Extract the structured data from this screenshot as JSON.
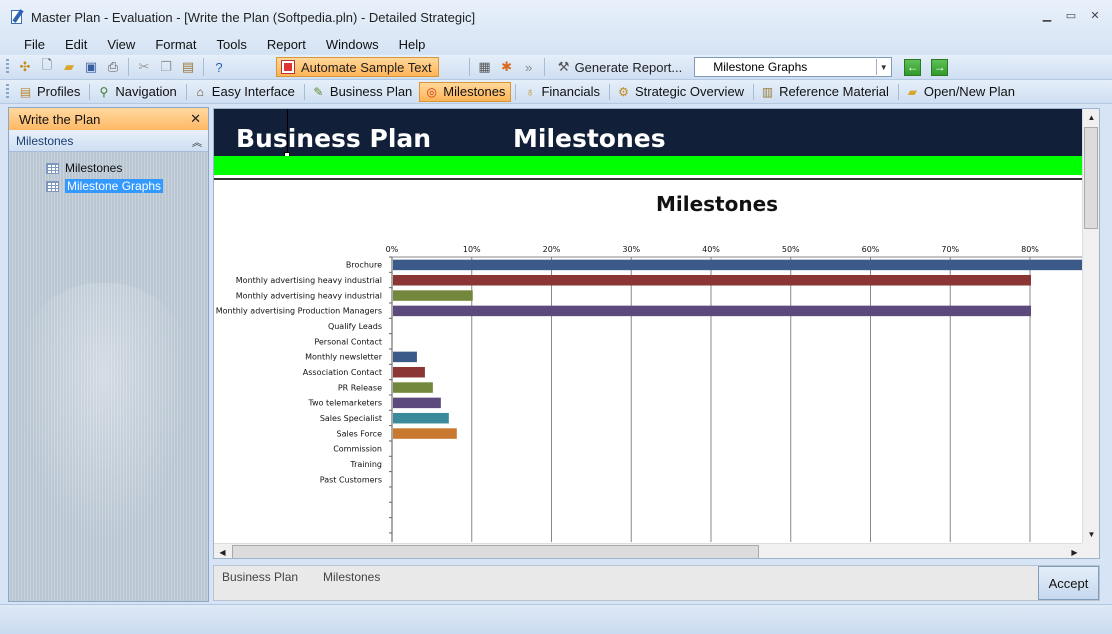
{
  "window": {
    "title": "Master Plan - Evaluation - [Write the Plan (Softpedia.pln) - Detailed Strategic]",
    "controls": [
      "minimize-icon",
      "restore-icon",
      "close-icon"
    ]
  },
  "menu": {
    "items": [
      "File",
      "Edit",
      "View",
      "Format",
      "Tools",
      "Report",
      "Windows",
      "Help"
    ]
  },
  "toolbar": {
    "icons": [
      "tools-icon",
      "new-icon",
      "open-icon",
      "save-icon",
      "print-icon",
      "cut-icon",
      "copy-icon",
      "paste-icon",
      "help-icon"
    ],
    "automate_label": "Automate Sample Text",
    "generate_label": "Generate Report...",
    "view_select": "Milestone Graphs"
  },
  "tabs": [
    {
      "label": "Profiles",
      "icon": "profiles-icon",
      "active": false
    },
    {
      "label": "Navigation",
      "icon": "navigation-icon",
      "active": false
    },
    {
      "label": "Easy Interface",
      "icon": "home-icon",
      "active": false
    },
    {
      "label": "Business Plan",
      "icon": "pencil-icon",
      "active": false
    },
    {
      "label": "Milestones",
      "icon": "milestones-icon",
      "active": true
    },
    {
      "label": "Financials",
      "icon": "money-bag-icon",
      "active": false
    },
    {
      "label": "Strategic Overview",
      "icon": "gear-icon",
      "active": false
    },
    {
      "label": "Reference Material",
      "icon": "books-icon",
      "active": false
    },
    {
      "label": "Open/New Plan",
      "icon": "folder-icon",
      "active": false
    }
  ],
  "sidebar": {
    "header": "Write the Plan",
    "section": "Milestones",
    "items": [
      {
        "label": "Milestones",
        "selected": false
      },
      {
        "label": "Milestone Graphs",
        "selected": true
      }
    ]
  },
  "content": {
    "banner_left": "Business Plan",
    "banner_right": "Milestones",
    "accent_green": "#00ff00",
    "banner_color": "#112038"
  },
  "chart_data": {
    "type": "bar",
    "orientation": "horizontal",
    "title": "Milestones",
    "xlabel": "",
    "ylabel": "",
    "xlim": [
      0,
      0.87
    ],
    "x_ticks": [
      "0%",
      "10%",
      "20%",
      "30%",
      "40%",
      "50%",
      "60%",
      "70%",
      "80%"
    ],
    "grid": true,
    "categories": [
      "Brochure",
      "Monthly advertising heavy industrial",
      "Monthly advertising heavy industrial",
      "Monthly advertising Production Managers",
      "Qualify Leads",
      "Personal Contact",
      "Monthly newsletter",
      "Association Contact",
      "PR Release",
      "Two telemarketers",
      "Sales Specialist",
      "Sales Force",
      "Commission",
      "Training",
      "Past Customers"
    ],
    "values": [
      0.87,
      0.8,
      0.1,
      0.8,
      0,
      0,
      0.03,
      0.04,
      0.05,
      0.06,
      0.07,
      0.08,
      0,
      0,
      0
    ],
    "colors": [
      "#3b5a8a",
      "#8b3535",
      "#74883d",
      "#5d4a7c",
      "#3b5a8a",
      "#3b5a8a",
      "#3b5a8a",
      "#8b3535",
      "#74883d",
      "#5d4a7c",
      "#3a8a9c",
      "#c9782f",
      "#3b5a8a",
      "#3b5a8a",
      "#3b5a8a"
    ]
  },
  "bottom": {
    "crumb1": "Business Plan",
    "crumb2": "Milestones",
    "accept_label": "Accept"
  }
}
